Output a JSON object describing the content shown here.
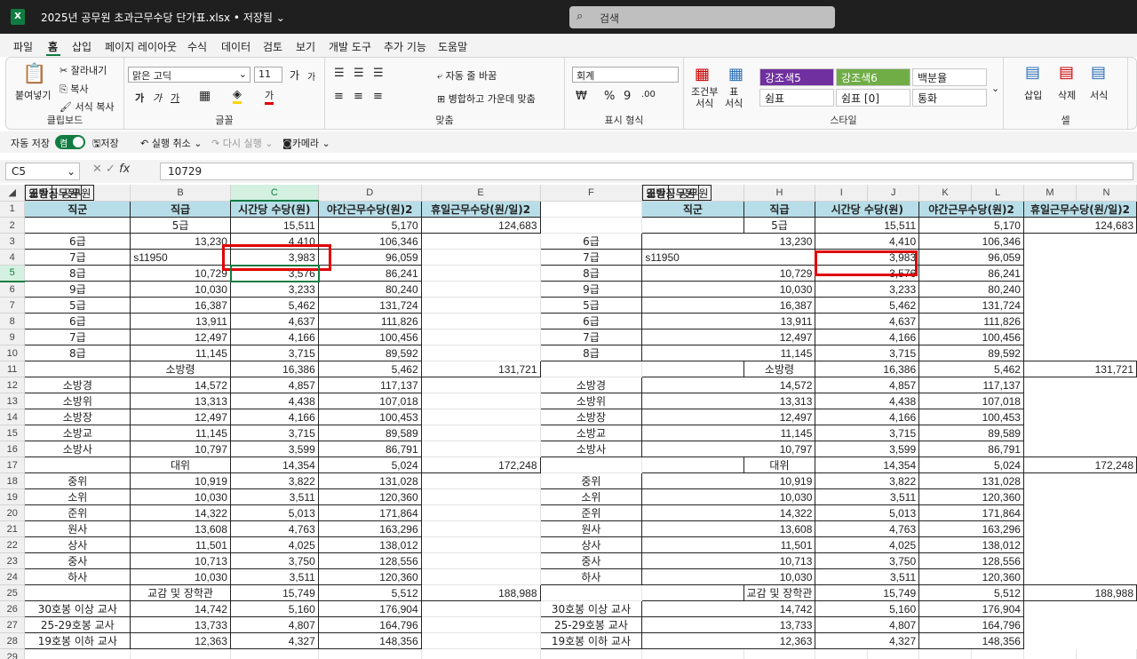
{
  "window": {
    "title": "2025년 공무원 초과근무수당 단가표.xlsx • 저장됨 ⌄",
    "logo": "X"
  },
  "search": {
    "placeholder": "검색",
    "icon": "search-icon"
  },
  "menu": [
    "파일",
    "홈",
    "삽입",
    "페이지 레이아웃",
    "수식",
    "데이터",
    "검토",
    "보기",
    "개발 도구",
    "추가 기능",
    "도움말"
  ],
  "ribbon": {
    "clipboard": {
      "paste": "붙여넣기",
      "cut": "잘라내기",
      "copy": "복사",
      "format_painter": "서식 복사",
      "label": "클립보드"
    },
    "font": {
      "name": "맑은 고딕",
      "size": "11",
      "grow": "가",
      "shrink": "가",
      "bold": "가",
      "italic": "가",
      "underline": "가",
      "font_color": "가",
      "label": "글꼴"
    },
    "align": {
      "wrap": "자동 줄 바꿈",
      "merge": "병합하고 가운데 맞춤",
      "label": "맞춤"
    },
    "number": {
      "format": "회계",
      "label": "표시 형식"
    },
    "conditional": "조건부\n서식",
    "table_fmt": "표\n서식",
    "styles": {
      "cells": [
        "강조색5",
        "강조색6",
        "백분율",
        "쉼표",
        "쉼표 [0]",
        "통화"
      ],
      "label": "스타일"
    },
    "cells": {
      "insert": "삽입",
      "delete": "삭제",
      "format": "서식",
      "label": "셀"
    }
  },
  "quick_access": {
    "autosave": "자동 저장",
    "toggle": "켬",
    "save": "저장",
    "undo": "실행 취소",
    "redo": "다시 실행",
    "camera": "카메라"
  },
  "formula_bar": {
    "name_box": "C5",
    "fx": "fx",
    "value": "10729"
  },
  "col_headers": [
    "A",
    "B",
    "C",
    "D",
    "E",
    "F",
    "G",
    "H",
    "I",
    "J",
    "K",
    "L",
    "M",
    "N"
  ],
  "table1": {
    "headers": [
      "직군",
      "직급",
      "시간당 수당(원)",
      "야간근무수당(원)2",
      "휴일근무수당(원/일)2"
    ],
    "groups": [
      "일반직 공무원",
      "소방공무원",
      "군인",
      "교육공무원"
    ],
    "rows": [
      [
        "5급",
        "15,511",
        "5,170",
        "124,683"
      ],
      [
        "6급",
        "13,230",
        "4,410",
        "106,346"
      ],
      [
        "7급",
        "s11950",
        "3,983",
        "96,059"
      ],
      [
        "8급",
        "10,729",
        "3,576",
        "86,241"
      ],
      [
        "9급",
        "10,030",
        "3,233",
        "80,240"
      ],
      [
        "5급",
        "16,387",
        "5,462",
        "131,724"
      ],
      [
        "6급",
        "13,911",
        "4,637",
        "111,826"
      ],
      [
        "7급",
        "12,497",
        "4,166",
        "100,456"
      ],
      [
        "8급",
        "11,145",
        "3,715",
        "89,592"
      ],
      [
        "소방령",
        "16,386",
        "5,462",
        "131,721"
      ],
      [
        "소방경",
        "14,572",
        "4,857",
        "117,137"
      ],
      [
        "소방위",
        "13,313",
        "4,438",
        "107,018"
      ],
      [
        "소방장",
        "12,497",
        "4,166",
        "100,453"
      ],
      [
        "소방교",
        "11,145",
        "3,715",
        "89,589"
      ],
      [
        "소방사",
        "10,797",
        "3,599",
        "86,791"
      ],
      [
        "대위",
        "14,354",
        "5,024",
        "172,248"
      ],
      [
        "중위",
        "10,919",
        "3,822",
        "131,028"
      ],
      [
        "소위",
        "10,030",
        "3,511",
        "120,360"
      ],
      [
        "준위",
        "14,322",
        "5,013",
        "171,864"
      ],
      [
        "원사",
        "13,608",
        "4,763",
        "163,296"
      ],
      [
        "상사",
        "11,501",
        "4,025",
        "138,012"
      ],
      [
        "중사",
        "10,713",
        "3,750",
        "128,556"
      ],
      [
        "하사",
        "10,030",
        "3,511",
        "120,360"
      ],
      [
        "교감 및 장학관",
        "15,749",
        "5,512",
        "188,988"
      ],
      [
        "30호봉 이상 교사",
        "14,742",
        "5,160",
        "176,904"
      ],
      [
        "25-29호봉 교사",
        "13,733",
        "4,807",
        "164,796"
      ],
      [
        "19호봉 이하 교사",
        "12,363",
        "4,327",
        "148,356"
      ]
    ]
  }
}
